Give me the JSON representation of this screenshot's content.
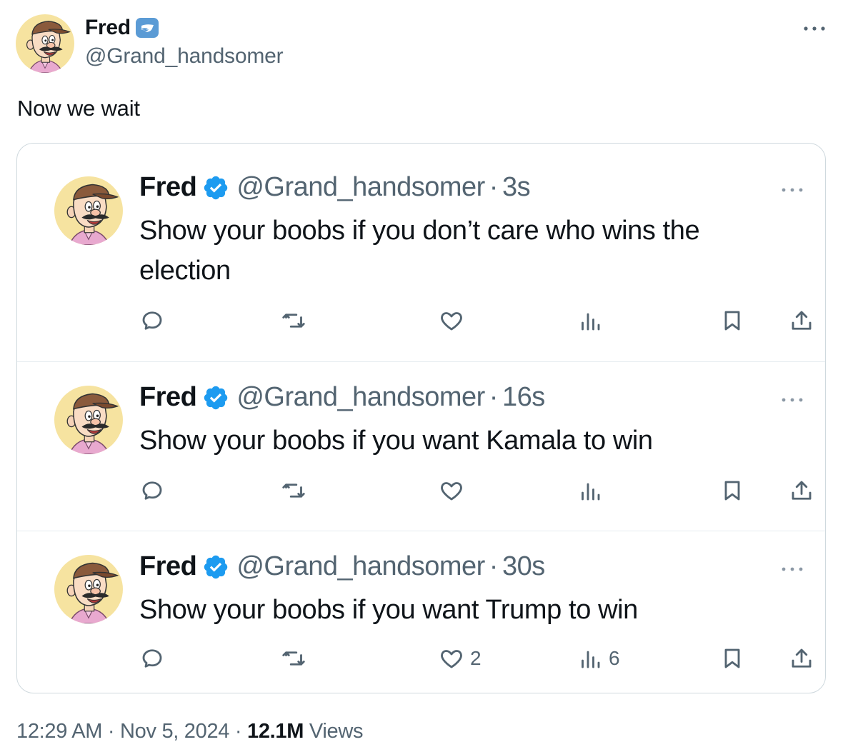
{
  "header": {
    "name": "Fred",
    "handle": "@Grand_handsomer",
    "badge_color": "#5b9bd5"
  },
  "main_text": "Now we wait",
  "thread": [
    {
      "name": "Fred",
      "handle": "@Grand_handsomer",
      "separator": "·",
      "time": "3s",
      "text": "Show your boobs if you don’t care who wins the election",
      "likes": "",
      "views": ""
    },
    {
      "name": "Fred",
      "handle": "@Grand_handsomer",
      "separator": "·",
      "time": "16s",
      "text": "Show your boobs if you want Kamala to win",
      "likes": "",
      "views": ""
    },
    {
      "name": "Fred",
      "handle": "@Grand_handsomer",
      "separator": "·",
      "time": "30s",
      "text": "Show your boobs if you want Trump to win",
      "likes": "2",
      "views": "6"
    }
  ],
  "icons": {
    "reply": "reply-icon",
    "retweet": "retweet-icon",
    "like": "heart-icon",
    "views": "views-icon",
    "bookmark": "bookmark-icon",
    "share": "share-icon",
    "more": "more-icon",
    "verified": "verified-badge-icon"
  },
  "colors": {
    "text": "#0f1419",
    "secondary": "#536471",
    "verified": "#1d9bf0",
    "border": "#cfd9de"
  },
  "footer": {
    "time": "12:29 AM",
    "sep1": "·",
    "date": "Nov 5, 2024",
    "sep2": "·",
    "views_count": "12.1M",
    "views_label": "Views"
  }
}
